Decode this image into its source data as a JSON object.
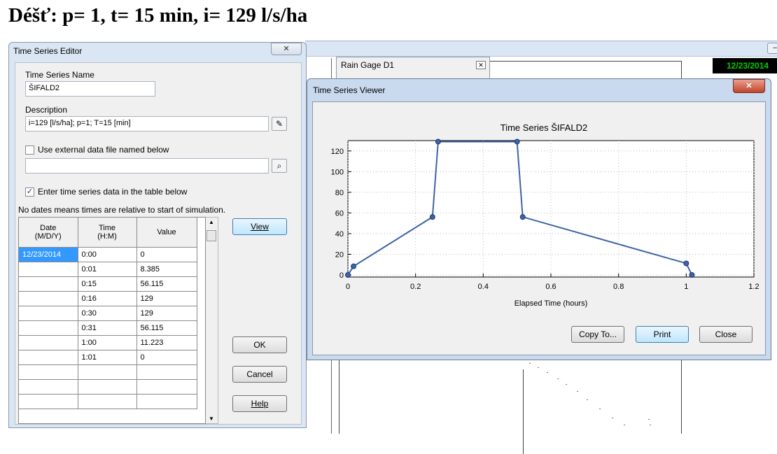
{
  "heading": "Déšť: p= 1, t= 15 min, i= 129 l/s/ha",
  "background_app": {
    "date": "12/23/2014",
    "rain_gage_title": "Rain Gage D1"
  },
  "editor": {
    "title": "Time Series Editor",
    "name_label": "Time Series Name",
    "name_value": "ŠIFALD2",
    "description_label": "Description",
    "description_value": "i=129 [l/s/ha]; p=1; T=15 [min]",
    "external_checkbox_label": "Use external data file named below",
    "external_checked": false,
    "external_file_value": "",
    "table_checkbox_label": "Enter time series data in the table below",
    "table_checked": true,
    "note": "No dates means times are relative to start of simulation.",
    "columns": {
      "date_line1": "Date",
      "date_line2": "(M/D/Y)",
      "time_line1": "Time",
      "time_line2": "(H:M)",
      "value": "Value"
    },
    "rows": [
      {
        "date": "12/23/2014",
        "time": "0:00",
        "value": "0"
      },
      {
        "date": "",
        "time": "0:01",
        "value": "8.385"
      },
      {
        "date": "",
        "time": "0:15",
        "value": "56.115"
      },
      {
        "date": "",
        "time": "0:16",
        "value": "129"
      },
      {
        "date": "",
        "time": "0:30",
        "value": "129"
      },
      {
        "date": "",
        "time": "0:31",
        "value": "56.115"
      },
      {
        "date": "",
        "time": "1:00",
        "value": "11.223"
      },
      {
        "date": "",
        "time": "1:01",
        "value": "0"
      },
      {
        "date": "",
        "time": "",
        "value": ""
      },
      {
        "date": "",
        "time": "",
        "value": ""
      },
      {
        "date": "",
        "time": "",
        "value": ""
      }
    ],
    "view_label": "View",
    "ok_label": "OK",
    "cancel_label": "Cancel",
    "help_label": "Help"
  },
  "viewer": {
    "title": "Time Series Viewer",
    "copy_label": "Copy To...",
    "print_label": "Print",
    "close_label": "Close"
  },
  "chart_data": {
    "type": "line",
    "title": "Time Series ŠIFALD2",
    "xlabel": "Elapsed Time (hours)",
    "ylabel": "",
    "xlim": [
      0,
      1.2
    ],
    "ylim": [
      0,
      130
    ],
    "x_ticks": [
      "0",
      "0.2",
      "0.4",
      "0.6",
      "0.8",
      "1",
      "1.2"
    ],
    "y_ticks": [
      "0",
      "20",
      "40",
      "60",
      "80",
      "100",
      "120"
    ],
    "grid": true,
    "series": [
      {
        "x": [
          0,
          0.0167,
          0.25,
          0.2667,
          0.5,
          0.5167,
          1.0,
          1.0167
        ],
        "y": [
          0,
          8.385,
          56.115,
          129,
          129,
          56.115,
          11.223,
          0
        ],
        "color": "#3f63a8"
      }
    ]
  }
}
